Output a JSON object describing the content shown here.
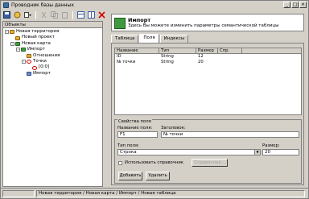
{
  "window": {
    "title": "Проводник базы данных",
    "min": "_",
    "max": "□",
    "close": "×"
  },
  "toolbar": {
    "icons": [
      "save-icon",
      "new-icon",
      "new-dropdown-icon",
      "cut-icon",
      "copy-icon",
      "paste-icon",
      "tool1-icon",
      "tool2-icon",
      "delete-icon"
    ]
  },
  "left_panel": {
    "header": "Объекты",
    "tree": [
      {
        "label": "Новая территория",
        "level": 0,
        "expander": "-",
        "icon": "territory"
      },
      {
        "label": "Новый проект",
        "level": 1,
        "expander": "",
        "icon": "proj"
      },
      {
        "label": "Новая карта",
        "level": 1,
        "expander": "-",
        "icon": "map"
      },
      {
        "label": "Импорт",
        "level": 2,
        "expander": "-",
        "icon": "map"
      },
      {
        "label": "Отношения",
        "level": 3,
        "expander": "",
        "icon": "proj"
      },
      {
        "label": "Точки",
        "level": 3,
        "expander": "-",
        "icon": "pt"
      },
      {
        "label": "[0:0]",
        "level": 4,
        "expander": "",
        "icon": "pt"
      },
      {
        "label": "Импорт",
        "level": 3,
        "expander": "",
        "icon": "tbl"
      }
    ]
  },
  "banner": {
    "title": "Импорт",
    "subtitle": "Здесь Вы можете изменить параметры семантической таблицы"
  },
  "tabs": [
    {
      "label": "Таблица",
      "active": false
    },
    {
      "label": "Поля",
      "active": true
    },
    {
      "label": "Индексы",
      "active": false
    }
  ],
  "grid": {
    "columns": [
      "Название",
      "Тип",
      "Размер",
      "Спр."
    ],
    "rows": [
      {
        "name": "ID",
        "type": "String",
        "size": "12",
        "ref": ""
      },
      {
        "name": "№ точки",
        "type": "String",
        "size": "20",
        "ref": ""
      }
    ]
  },
  "field_props": {
    "legend": "Свойства поля",
    "name_label": "Название поля:",
    "name_value": "F1",
    "caption_label": "Заголовок:",
    "caption_value": "№ точки",
    "type_label": "Тип поля:",
    "type_value": "Строка",
    "size_label": "Размер:",
    "size_value": "20",
    "use_ref_label": "Использовать справочник",
    "ref_button": "Справочник..."
  },
  "buttons": {
    "add": "Добавить",
    "delete": "Удалить"
  },
  "status": {
    "path": "Новая территория / Новая карта / Импорт / Новая таблица"
  }
}
